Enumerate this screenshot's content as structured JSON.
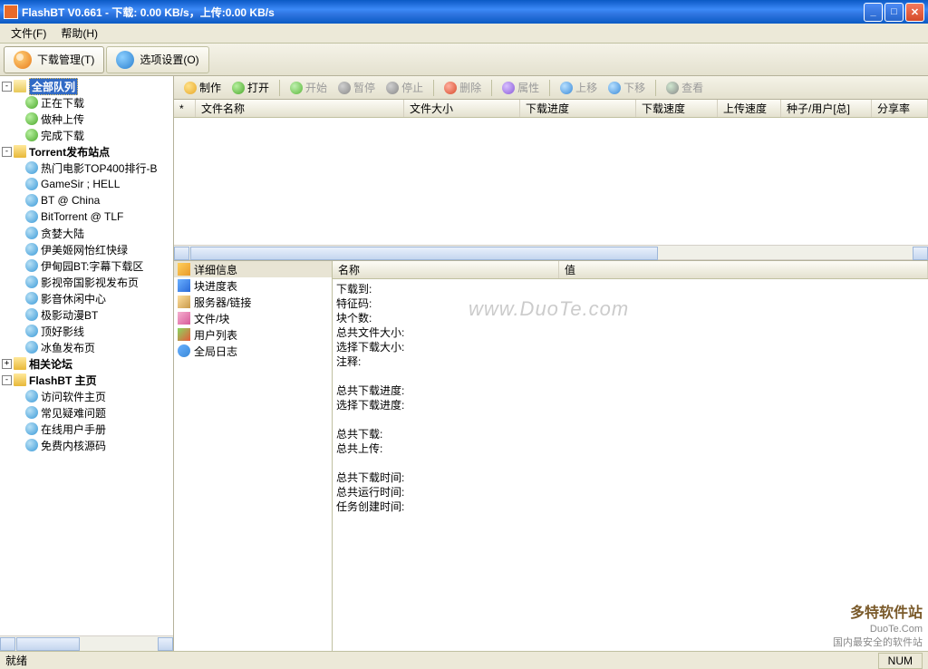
{
  "title": "FlashBT V0.661 - 下载: 0.00 KB/s，上传:0.00 KB/s",
  "menu": {
    "file": "文件(F)",
    "help": "帮助(H)"
  },
  "tabs": {
    "download_manager": "下载管理(T)",
    "options": "选项设置(O)"
  },
  "actions": {
    "make": "制作",
    "open": "打开",
    "start": "开始",
    "pause": "暂停",
    "stop": "停止",
    "delete": "删除",
    "props": "属性",
    "up": "上移",
    "down": "下移",
    "view": "查看"
  },
  "list_cols": {
    "star": "*",
    "name": "文件名称",
    "size": "文件大小",
    "progress": "下载进度",
    "dl_speed": "下载速度",
    "ul_speed": "上传速度",
    "seed_peer": "种子/用户[总]",
    "ratio": "分享率"
  },
  "tree": {
    "all_queue": "全部队列",
    "all_children": [
      "正在下载",
      "做种上传",
      "完成下载"
    ],
    "torrent_sites": "Torrent发布站点",
    "torrent_children": [
      "热门电影TOP400排行-B",
      "GameSir ; HELL",
      "BT @ China",
      "BitTorrent @ TLF",
      "贪婪大陆",
      "伊美姬网怡红快绿",
      "伊甸园BT:字幕下载区",
      "影视帝国影视发布页",
      "影音休闲中心",
      "极影动漫BT",
      "顶好影线",
      "冰鱼发布页"
    ],
    "forums": "相关论坛",
    "flashbt_home": "FlashBT 主页",
    "flashbt_children": [
      "访问软件主页",
      "常见疑难问题",
      "在线用户手册",
      "免费内核源码"
    ]
  },
  "detail_tabs": [
    "详细信息",
    "块进度表",
    "服务器/链接",
    "文件/块",
    "用户列表",
    "全局日志"
  ],
  "detail_cols": {
    "name": "名称",
    "value": "值"
  },
  "detail_rows": [
    "下载到:",
    "特征码:",
    "块个数:",
    "总共文件大小:",
    "选择下载大小:",
    "注释:",
    "",
    "总共下载进度:",
    "选择下载进度:",
    "",
    "总共下载:",
    "总共上传:",
    "",
    "总共下载时间:",
    "总共运行时间:",
    "任务创建时间:"
  ],
  "status": {
    "ready": "就绪",
    "num": "NUM"
  },
  "watermark": "www.DuoTe.com",
  "footer": {
    "brand": "多特软件站",
    "domain": "DuoTe.Com",
    "slogan": "国内最安全的软件站"
  }
}
